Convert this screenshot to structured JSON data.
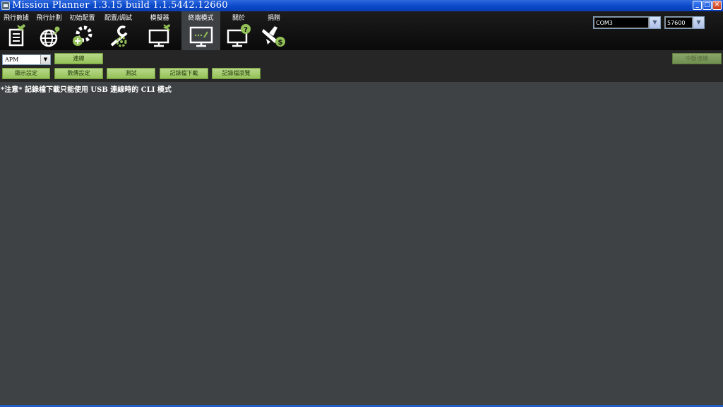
{
  "window": {
    "title": "Mission Planner 1.3.15 build 1.1.5442.12660",
    "minimize_glyph": "_",
    "maximize_glyph": "□",
    "close_glyph": "✕"
  },
  "menu": {
    "items": [
      {
        "label": "飛行數據",
        "icon": "flight-data-icon"
      },
      {
        "label": "飛行計劃",
        "icon": "flight-plan-icon"
      },
      {
        "label": "初始配置",
        "icon": "initial-setup-icon"
      },
      {
        "label": "配置/調試",
        "icon": "config-tuning-icon"
      },
      {
        "label": "模擬器",
        "icon": "simulator-icon"
      },
      {
        "label": "終端模式",
        "icon": "terminal-icon"
      },
      {
        "label": "關於",
        "icon": "help-icon"
      },
      {
        "label": "捐贈",
        "icon": "donate-icon"
      }
    ],
    "active_index": 5
  },
  "connection": {
    "port": "COM3",
    "baud": "57600"
  },
  "terminal_toolbar": {
    "target": "APM",
    "connect_label": "連線",
    "disconnect_label": "中斷連線",
    "buttons": [
      "顯示設定",
      "數傳設定",
      "測試",
      "記錄檔下載",
      "記錄檔瀏覽"
    ]
  },
  "terminal": {
    "notice": "*注意* 記錄檔下載只能使用 USB 連線時的 CLI 模式"
  },
  "colors": {
    "accent_green": "#93c157",
    "menu_bg": "#111111",
    "terminal_bg": "#3e4244",
    "titlebar_blue": "#0b48c9"
  }
}
